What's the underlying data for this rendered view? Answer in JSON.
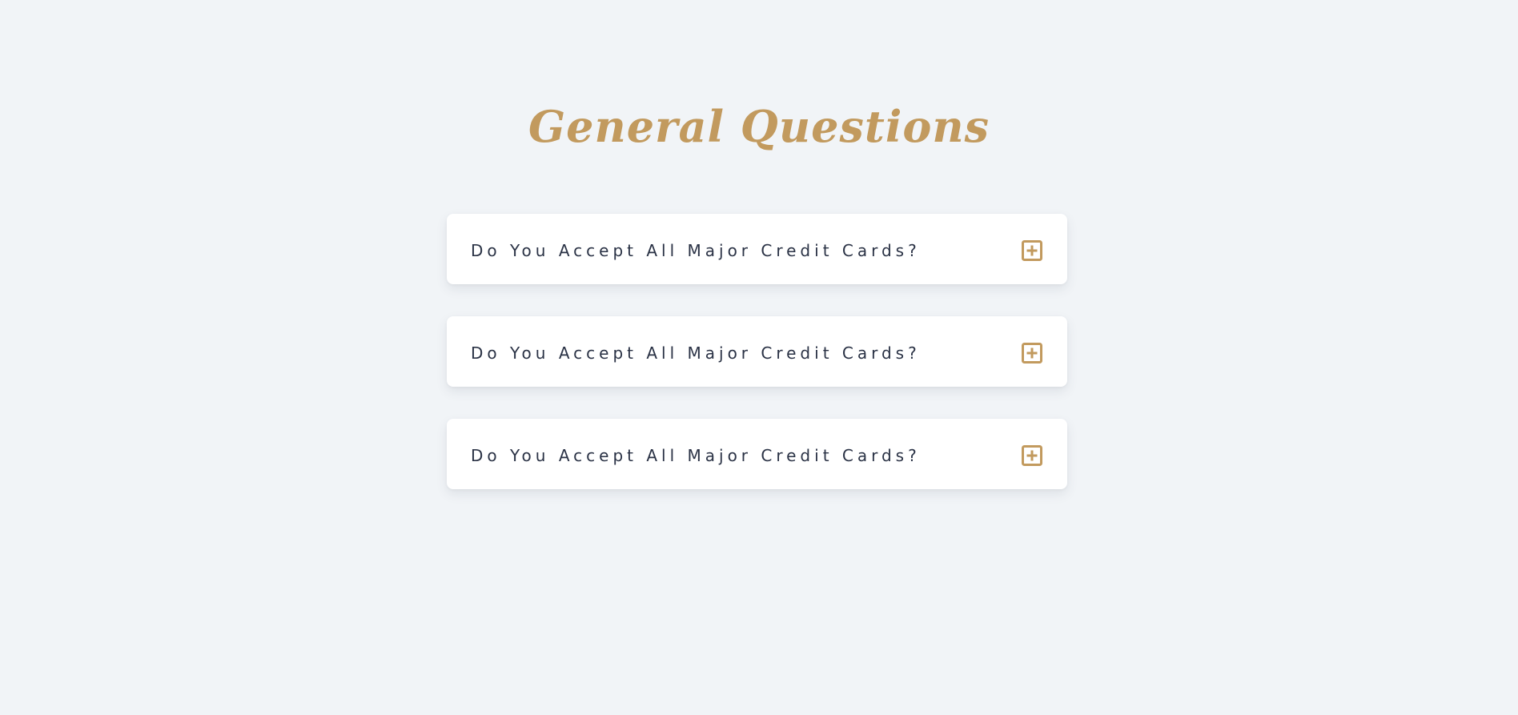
{
  "heading": "General Questions",
  "colors": {
    "accent": "#c29a5e",
    "background": "#f1f4f7",
    "text": "#2a3245",
    "card": "#ffffff"
  },
  "faq": {
    "items": [
      {
        "question": "Do You Accept All Major Credit Cards?",
        "icon": "plus-square-icon"
      },
      {
        "question": "Do You Accept All Major Credit Cards?",
        "icon": "plus-square-icon"
      },
      {
        "question": "Do You Accept All Major Credit Cards?",
        "icon": "plus-square-icon"
      }
    ]
  }
}
